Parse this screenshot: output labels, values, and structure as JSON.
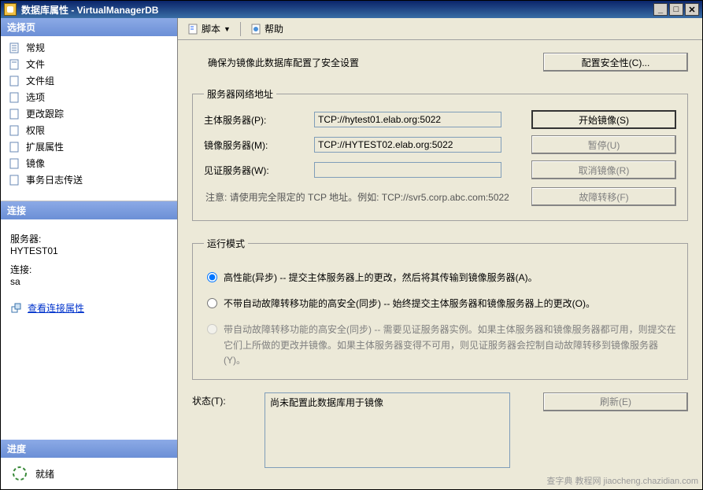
{
  "window": {
    "title": "数据库属性 - VirtualManagerDB"
  },
  "sidebar": {
    "select_header": "选择页",
    "items": [
      {
        "label": "常规"
      },
      {
        "label": "文件"
      },
      {
        "label": "文件组"
      },
      {
        "label": "选项"
      },
      {
        "label": "更改跟踪"
      },
      {
        "label": "权限"
      },
      {
        "label": "扩展属性"
      },
      {
        "label": "镜像"
      },
      {
        "label": "事务日志传送"
      }
    ],
    "connection_header": "连接",
    "server_label": "服务器:",
    "server_value": "HYTEST01",
    "connection_label": "连接:",
    "connection_value": "sa",
    "view_conn_props": "查看连接属性",
    "progress_header": "进度",
    "progress_status": "就绪"
  },
  "toolbar": {
    "script": "脚本",
    "help": "帮助"
  },
  "main": {
    "intro": "确保为镜像此数据库配置了安全设置",
    "configure_security_btn": "配置安全性(C)...",
    "addr_group": "服务器网络地址",
    "principal_label": "主体服务器(P):",
    "principal_value": "TCP://hytest01.elab.org:5022",
    "mirror_label": "镜像服务器(M):",
    "mirror_value": "TCP://HYTEST02.elab.org:5022",
    "witness_label": "见证服务器(W):",
    "witness_value": "",
    "note": "注意: 请使用完全限定的 TCP 地址。例如: TCP://svr5.corp.abc.com:5022",
    "start_btn": "开始镜像(S)",
    "pause_btn": "暂停(U)",
    "remove_btn": "取消镜像(R)",
    "failover_btn": "故障转移(F)",
    "mode_group": "运行模式",
    "radio_async": "高性能(异步) -- 提交主体服务器上的更改，然后将其传输到镜像服务器(A)。",
    "radio_sync_no_fail": "不带自动故障转移功能的高安全(同步) -- 始终提交主体服务器和镜像服务器上的更改(O)。",
    "radio_sync_fail": "带自动故障转移功能的高安全(同步) -- 需要见证服务器实例。如果主体服务器和镜像服务器都可用，则提交在它们上所做的更改并镜像。如果主体服务器变得不可用，则见证服务器会控制自动故障转移到镜像服务器(Y)。",
    "status_label": "状态(T):",
    "status_value": "尚未配置此数据库用于镜像",
    "refresh_btn": "刷新(E)"
  },
  "watermark": "查字典  教程网\njiaocheng.chazidian.com"
}
